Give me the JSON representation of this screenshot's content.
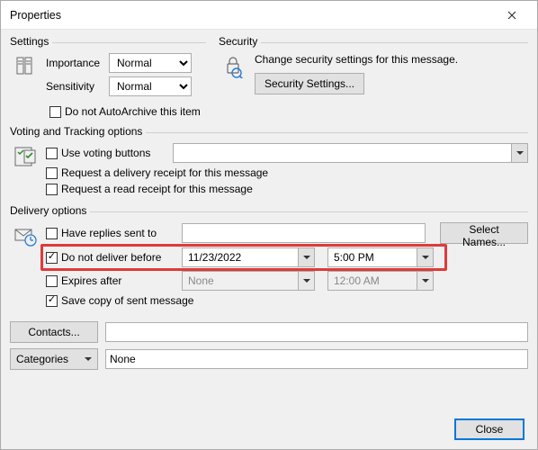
{
  "window": {
    "title": "Properties"
  },
  "settings": {
    "legend": "Settings",
    "importance_label": "Importance",
    "importance_value": "Normal",
    "sensitivity_label": "Sensitivity",
    "sensitivity_value": "Normal",
    "autoarchive_label": "Do not AutoArchive this item",
    "autoarchive_checked": false
  },
  "security": {
    "legend": "Security",
    "description": "Change security settings for this message.",
    "button": "Security Settings..."
  },
  "voting": {
    "legend": "Voting and Tracking options",
    "use_voting_label": "Use voting buttons",
    "use_voting_checked": false,
    "voting_value": "",
    "delivery_receipt_label": "Request a delivery receipt for this message",
    "delivery_receipt_checked": false,
    "read_receipt_label": "Request a read receipt for this message",
    "read_receipt_checked": false
  },
  "delivery": {
    "legend": "Delivery options",
    "have_replies_label": "Have replies sent to",
    "have_replies_checked": false,
    "have_replies_value": "",
    "select_names_button": "Select Names...",
    "do_not_deliver_label": "Do not deliver before",
    "do_not_deliver_checked": true,
    "do_not_deliver_date": "11/23/2022",
    "do_not_deliver_time": "5:00 PM",
    "expires_label": "Expires after",
    "expires_checked": false,
    "expires_date": "None",
    "expires_time": "12:00 AM",
    "save_copy_label": "Save copy of sent message",
    "save_copy_checked": true
  },
  "bottom": {
    "contacts_button": "Contacts...",
    "contacts_value": "",
    "categories_button": "Categories",
    "categories_value": "None"
  },
  "footer": {
    "close_button": "Close"
  }
}
